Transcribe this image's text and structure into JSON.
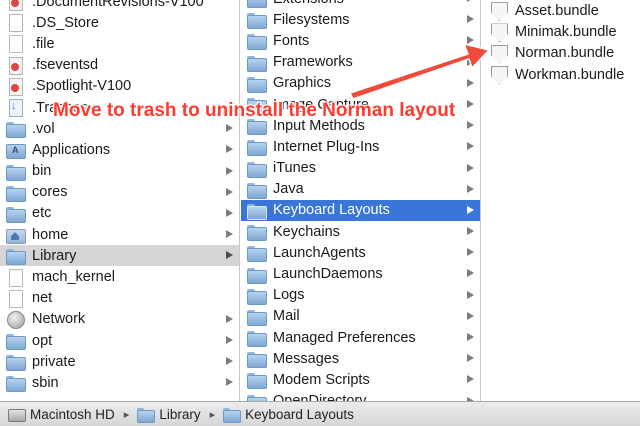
{
  "columns": {
    "root": {
      "items": [
        {
          "label": ".DocumentRevisions-V100",
          "icon": "restricted-folder-icon",
          "kind": "noent",
          "arrow": false
        },
        {
          "label": ".DS_Store",
          "icon": "document-icon",
          "kind": "doc",
          "arrow": false
        },
        {
          "label": ".file",
          "icon": "document-icon",
          "kind": "doc",
          "arrow": false
        },
        {
          "label": ".fseventsd",
          "icon": "restricted-folder-icon",
          "kind": "noent",
          "arrow": false
        },
        {
          "label": ".Spotlight-V100",
          "icon": "restricted-folder-icon",
          "kind": "noent",
          "arrow": false
        },
        {
          "label": ".Trashes",
          "icon": "trash-folder-icon",
          "kind": "trash",
          "arrow": false
        },
        {
          "label": ".vol",
          "icon": "folder-icon",
          "kind": "fold",
          "arrow": true
        },
        {
          "label": "Applications",
          "icon": "applications-folder-icon",
          "kind": "appf",
          "arrow": true
        },
        {
          "label": "bin",
          "icon": "folder-icon",
          "kind": "fold",
          "arrow": true
        },
        {
          "label": "cores",
          "icon": "folder-icon",
          "kind": "fold",
          "arrow": true
        },
        {
          "label": "etc",
          "icon": "folder-icon",
          "kind": "fold",
          "arrow": true
        },
        {
          "label": "home",
          "icon": "home-folder-icon",
          "kind": "home",
          "arrow": true
        },
        {
          "label": "Library",
          "icon": "folder-icon",
          "kind": "fold",
          "arrow": true,
          "selected": "grey"
        },
        {
          "label": "mach_kernel",
          "icon": "document-icon",
          "kind": "doc",
          "arrow": false
        },
        {
          "label": "net",
          "icon": "document-icon",
          "kind": "doc",
          "arrow": false
        },
        {
          "label": "Network",
          "icon": "network-globe-icon",
          "kind": "globe",
          "arrow": true
        },
        {
          "label": "opt",
          "icon": "folder-icon",
          "kind": "fold",
          "arrow": true
        },
        {
          "label": "private",
          "icon": "folder-icon",
          "kind": "fold",
          "arrow": true
        },
        {
          "label": "sbin",
          "icon": "folder-icon",
          "kind": "fold",
          "arrow": true
        }
      ]
    },
    "library": {
      "items": [
        {
          "label": "Extensions",
          "icon": "folder-icon",
          "kind": "fold",
          "arrow": true
        },
        {
          "label": "Filesystems",
          "icon": "folder-icon",
          "kind": "fold",
          "arrow": true
        },
        {
          "label": "Fonts",
          "icon": "folder-icon",
          "kind": "fold",
          "arrow": true
        },
        {
          "label": "Frameworks",
          "icon": "folder-icon",
          "kind": "fold",
          "arrow": true
        },
        {
          "label": "Graphics",
          "icon": "folder-icon",
          "kind": "fold",
          "arrow": true
        },
        {
          "label": "Image Capture",
          "icon": "folder-icon",
          "kind": "fold",
          "arrow": true
        },
        {
          "label": "Input Methods",
          "icon": "folder-icon",
          "kind": "fold",
          "arrow": true
        },
        {
          "label": "Internet Plug-Ins",
          "icon": "folder-icon",
          "kind": "fold",
          "arrow": true
        },
        {
          "label": "iTunes",
          "icon": "folder-icon",
          "kind": "fold",
          "arrow": true
        },
        {
          "label": "Java",
          "icon": "folder-icon",
          "kind": "fold",
          "arrow": true
        },
        {
          "label": "Keyboard Layouts",
          "icon": "folder-icon",
          "kind": "fold",
          "arrow": true,
          "selected": "blue"
        },
        {
          "label": "Keychains",
          "icon": "folder-icon",
          "kind": "fold",
          "arrow": true
        },
        {
          "label": "LaunchAgents",
          "icon": "folder-icon",
          "kind": "fold",
          "arrow": true
        },
        {
          "label": "LaunchDaemons",
          "icon": "folder-icon",
          "kind": "fold",
          "arrow": true
        },
        {
          "label": "Logs",
          "icon": "folder-icon",
          "kind": "fold",
          "arrow": true
        },
        {
          "label": "Mail",
          "icon": "folder-icon",
          "kind": "fold",
          "arrow": true
        },
        {
          "label": "Managed Preferences",
          "icon": "folder-icon",
          "kind": "fold",
          "arrow": true
        },
        {
          "label": "Messages",
          "icon": "folder-icon",
          "kind": "fold",
          "arrow": true
        },
        {
          "label": "Modem Scripts",
          "icon": "folder-icon",
          "kind": "fold",
          "arrow": true
        },
        {
          "label": "OpenDirectory",
          "icon": "folder-icon",
          "kind": "fold",
          "arrow": true
        }
      ]
    },
    "keyboard_layouts": {
      "items": [
        {
          "label": "Asset.bundle",
          "icon": "bundle-shield-icon",
          "kind": "shield",
          "arrow": false
        },
        {
          "label": "Minimak.bundle",
          "icon": "bundle-shield-icon",
          "kind": "shield",
          "arrow": false
        },
        {
          "label": "Norman.bundle",
          "icon": "bundle-shield-icon",
          "kind": "shield",
          "arrow": false
        },
        {
          "label": "Workman.bundle",
          "icon": "bundle-shield-icon",
          "kind": "shield",
          "arrow": false
        }
      ]
    }
  },
  "path_bar": {
    "crumbs": [
      {
        "label": "Macintosh HD",
        "icon": "hard-drive-icon"
      },
      {
        "label": "Library",
        "icon": "folder-icon"
      },
      {
        "label": "Keyboard Layouts",
        "icon": "folder-icon"
      }
    ],
    "separator": "▸"
  },
  "annotation": {
    "text": "Move to trash to uninstall the Norman layout",
    "color": "#ff3b30"
  },
  "colors": {
    "selection_blue": "#3a76d8",
    "selection_grey": "#d5d5d5"
  }
}
